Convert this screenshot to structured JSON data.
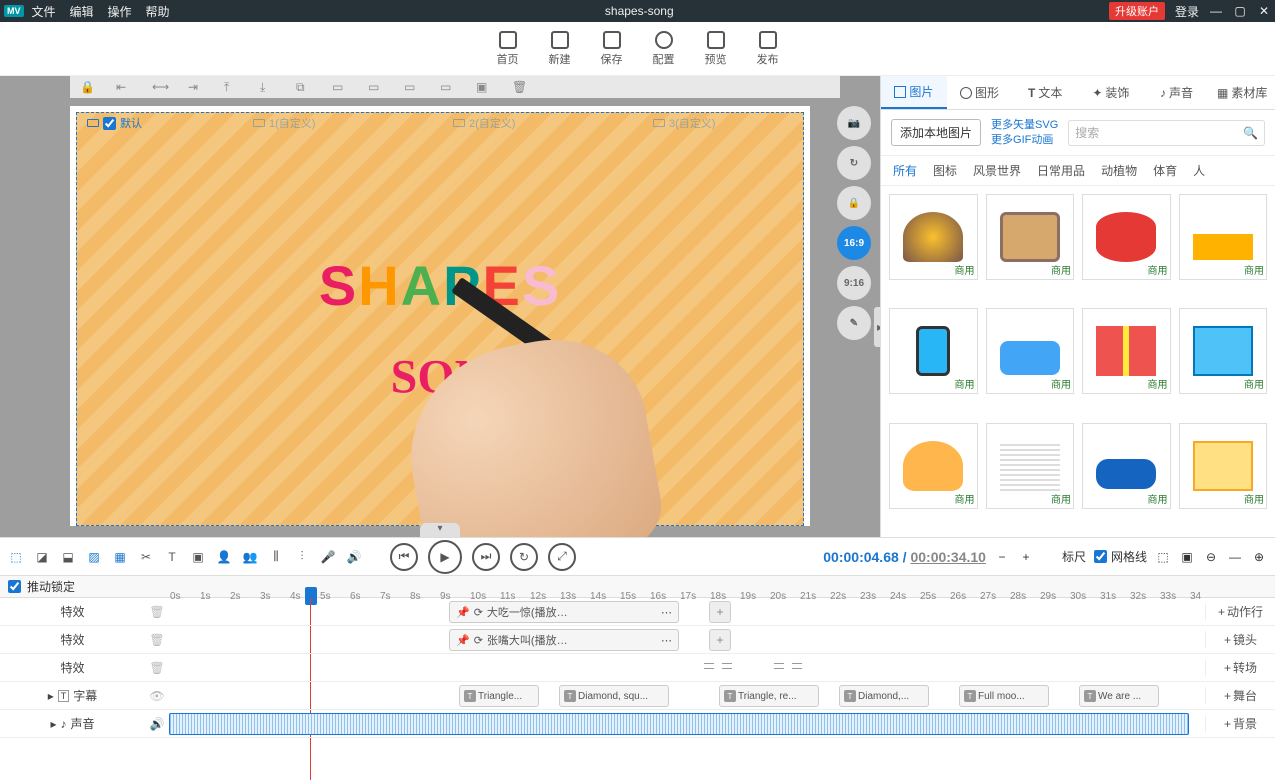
{
  "titlebar": {
    "logo": "MV",
    "menus": [
      "文件",
      "编辑",
      "操作",
      "帮助"
    ],
    "title": "shapes-song",
    "upgrade": "升级账户",
    "login": "登录"
  },
  "toptoolbar": [
    {
      "icon": "home",
      "label": "首页"
    },
    {
      "icon": "new",
      "label": "新建"
    },
    {
      "icon": "save",
      "label": "保存"
    },
    {
      "icon": "config",
      "label": "配置"
    },
    {
      "icon": "preview",
      "label": "预览"
    },
    {
      "icon": "publish",
      "label": "发布"
    }
  ],
  "scenes": [
    {
      "label": "默认",
      "active": true
    },
    {
      "label": "1(自定义)",
      "active": false
    },
    {
      "label": "2(自定义)",
      "active": false
    },
    {
      "label": "3(自定义)",
      "active": false
    }
  ],
  "canvas_text1": "SHAPES",
  "canvas_text2": "SON",
  "ratios": [
    {
      "label": "📷",
      "active": false
    },
    {
      "label": "↻",
      "active": false
    },
    {
      "label": "🔒",
      "active": false
    },
    {
      "label": "16:9",
      "active": true
    },
    {
      "label": "9:16",
      "active": false
    },
    {
      "label": "✎",
      "active": false
    }
  ],
  "rightpanel": {
    "tabs": [
      "图片",
      "图形",
      "文本",
      "装饰",
      "声音",
      "素材库"
    ],
    "active_tab": "图片",
    "add_local": "添加本地图片",
    "link1": "更多矢量SVG",
    "link2": "更多GIF动画",
    "search_placeholder": "搜索",
    "categories": [
      "所有",
      "图标",
      "风景世界",
      "日常用品",
      "动植物",
      "体育",
      "人"
    ],
    "active_cat": "所有",
    "tag": "商用"
  },
  "playbar": {
    "current": "00:00:04.68",
    "total": "00:00:34.10",
    "ruler_label": "标尺",
    "grid_label": "网格线"
  },
  "timeline": {
    "lock_label": "推动锁定",
    "ticks": [
      "0s",
      "1s",
      "2s",
      "3s",
      "4s",
      "5s",
      "6s",
      "7s",
      "8s",
      "9s",
      "10s",
      "11s",
      "12s",
      "13s",
      "14s",
      "15s",
      "16s",
      "17s",
      "18s",
      "19s",
      "20s",
      "21s",
      "22s",
      "23s",
      "24s",
      "25s",
      "26s",
      "27s",
      "28s",
      "29s",
      "30s",
      "31s",
      "32s",
      "33s",
      "34"
    ],
    "rows_label_fx": "特效",
    "rows_label_sub": "字幕",
    "rows_label_sound": "声音",
    "clip1": "大吃一惊(播放完消失)",
    "clip2": "张嘴大叫(播放完消失)",
    "subs": [
      "Triangle...",
      "Diamond, squ...",
      "Triangle, re...",
      "Diamond,...",
      "Full moo...",
      "We are ..."
    ],
    "addbtns": [
      "动作行",
      "镜头",
      "转场",
      "舞台",
      "背景"
    ]
  }
}
